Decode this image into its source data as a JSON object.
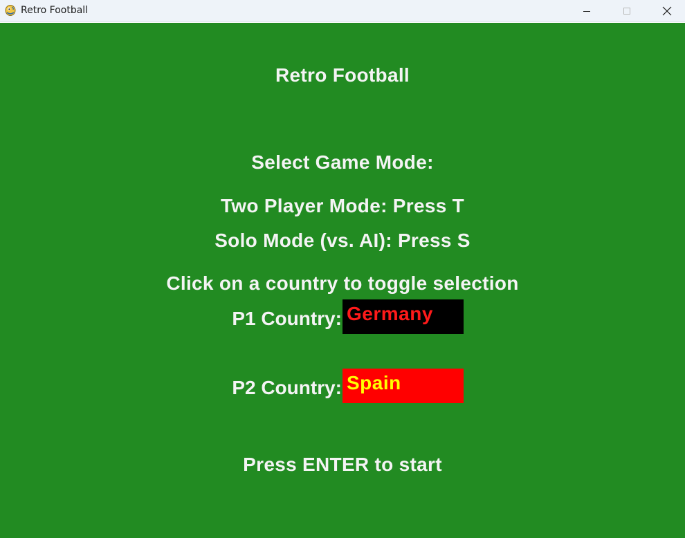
{
  "window": {
    "title": "Retro Football",
    "app_icon": "pygame-snake-icon",
    "controls": {
      "minimize_icon": "minimize-icon",
      "maximize_icon": "maximize-icon",
      "close_icon": "close-icon"
    }
  },
  "menu": {
    "title": "Retro Football",
    "select_mode": "Select Game Mode:",
    "two_player": "Two Player Mode: Press T",
    "solo": "Solo Mode (vs. AI): Press S",
    "click_hint": "Click on a country to toggle selection",
    "p1": {
      "label": "P1 Country:",
      "country": "Germany",
      "box_color": "#000000",
      "text_color": "#ff1a1a"
    },
    "p2": {
      "label": "P2 Country:",
      "country": "Spain",
      "box_color": "#ff0000",
      "text_color": "#ffff00"
    },
    "start_hint": "Press ENTER to start"
  },
  "colors": {
    "background": "#228b22",
    "text": "#f4f4f4",
    "titlebar": "#eef3f9"
  }
}
